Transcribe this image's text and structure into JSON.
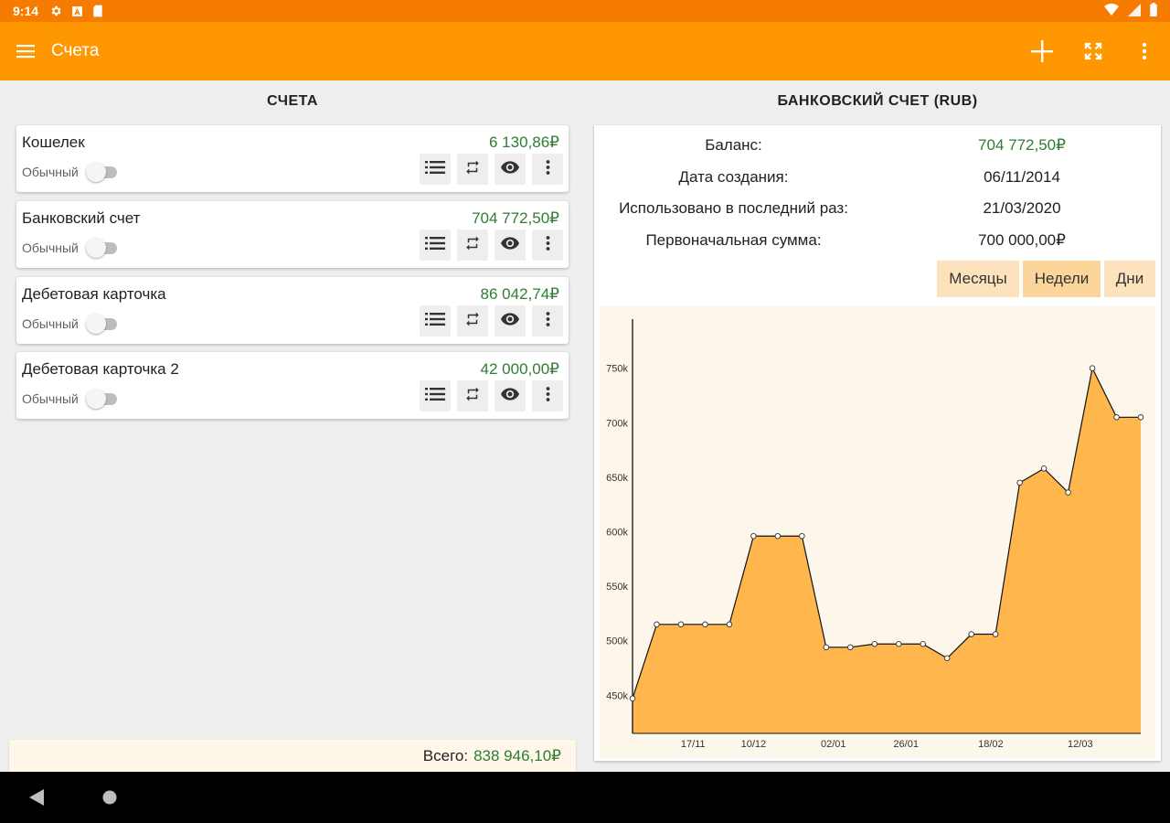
{
  "status_bar": {
    "time": "9:14",
    "left_icons": [
      "gear-icon",
      "a-badge-icon",
      "sd-card-icon"
    ],
    "right_icons": [
      "wifi-icon",
      "signal-icon",
      "battery-icon"
    ]
  },
  "app_bar": {
    "title": "Счета",
    "actions": [
      "add-icon",
      "fullscreen-icon",
      "more-vert-icon"
    ]
  },
  "accounts_panel": {
    "title": "СЧЕТА",
    "accounts": [
      {
        "name": "Кошелек",
        "amount": "6 130,86₽",
        "type": "Обычный"
      },
      {
        "name": "Банковский счет",
        "amount": "704 772,50₽",
        "type": "Обычный"
      },
      {
        "name": "Дебетовая карточка",
        "amount": "86 042,74₽",
        "type": "Обычный"
      },
      {
        "name": "Дебетовая карточка 2",
        "amount": "42 000,00₽",
        "type": "Обычный"
      }
    ],
    "total_label": "Всего:",
    "total_value": "838 946,10₽"
  },
  "detail_panel": {
    "title": "БАНКОВСКИЙ СЧЕТ (RUB)",
    "info": [
      {
        "label": "Баланс:",
        "value": "704 772,50₽",
        "color": "#2e7d32"
      },
      {
        "label": "Дата создания:",
        "value": "06/11/2014"
      },
      {
        "label": "Использовано в последний раз:",
        "value": "21/03/2020"
      },
      {
        "label": "Первоначальная сумма:",
        "value": "700 000,00₽"
      }
    ],
    "periods": [
      "Месяцы",
      "Недели",
      "Дни"
    ],
    "active_period": "Недели"
  },
  "chart_data": {
    "type": "area",
    "y_tick_labels": [
      "450k",
      "500k",
      "550k",
      "600k",
      "650k",
      "700k",
      "750k"
    ],
    "y_ticks": [
      450000,
      500000,
      550000,
      600000,
      650000,
      700000,
      750000
    ],
    "x_tick_labels": [
      "17/11",
      "10/12",
      "02/01",
      "26/01",
      "18/02",
      "12/03"
    ],
    "x_tick_index": [
      2.5,
      5,
      8.3,
      11.3,
      14.8,
      18.5
    ],
    "ylim": [
      415000,
      795000
    ],
    "fill_color": "#ffb74d",
    "values": [
      447000,
      515000,
      515000,
      515000,
      515000,
      596000,
      596000,
      596000,
      494000,
      494000,
      497000,
      497000,
      497000,
      484000,
      506000,
      506000,
      645000,
      658000,
      636000,
      750000,
      705000,
      705000
    ],
    "grid": false
  }
}
